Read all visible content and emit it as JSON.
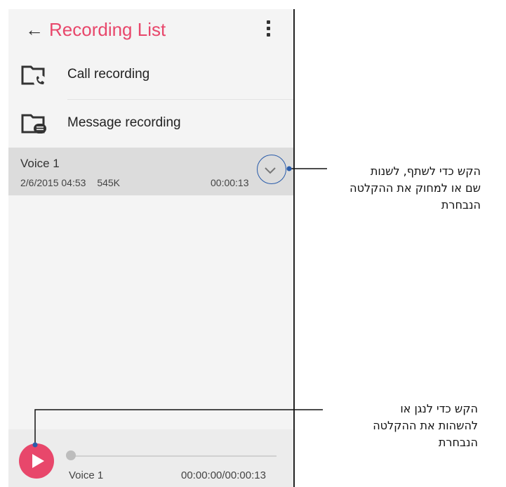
{
  "app": {
    "title": "Recording List"
  },
  "icons": {
    "back": "back-arrow-icon",
    "more": "more-vertical-icon",
    "call_folder": "call-folder-icon",
    "message_folder": "message-folder-icon",
    "expand": "chevron-down-icon",
    "play": "play-icon"
  },
  "folders": [
    {
      "label": "Call recording"
    },
    {
      "label": "Message recording"
    }
  ],
  "recordings": [
    {
      "name": "Voice 1",
      "date": "2/6/2015 04:53",
      "size": "545K",
      "duration": "00:00:13"
    }
  ],
  "player": {
    "name": "Voice 1",
    "time": "00:00:00/00:00:13",
    "progress": 0
  },
  "annotations": {
    "expand_callout": [
      "הקש כדי לשתף, לשנות",
      "שם או למחוק את ההקלטה",
      "הנבחרת"
    ],
    "play_callout": [
      "הקש כדי לנגן או",
      "להשהות את ההקלטה",
      "הנבחרת"
    ]
  },
  "colors": {
    "accent": "#e8476b",
    "callout_line": "#2a5caa",
    "selected_row": "#dcdcdc"
  }
}
